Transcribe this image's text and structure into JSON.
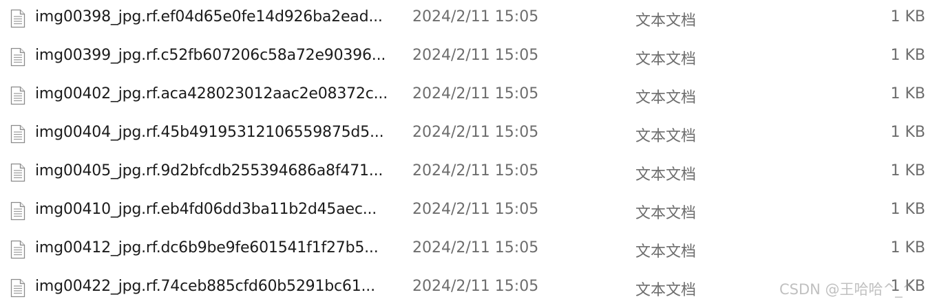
{
  "files": [
    {
      "name": "img00398_jpg.rf.ef04d65e0fe14d926ba2ead...",
      "date": "2024/2/11 15:05",
      "type": "文本文档",
      "size": "1 KB",
      "icon": "text-document-icon"
    },
    {
      "name": "img00399_jpg.rf.c52fb607206c58a72e90396...",
      "date": "2024/2/11 15:05",
      "type": "文本文档",
      "size": "1 KB",
      "icon": "text-document-icon"
    },
    {
      "name": "img00402_jpg.rf.aca428023012aac2e08372c...",
      "date": "2024/2/11 15:05",
      "type": "文本文档",
      "size": "1 KB",
      "icon": "text-document-icon"
    },
    {
      "name": "img00404_jpg.rf.45b491953121065598 75d5...",
      "date": "2024/2/11 15:05",
      "type": "文本文档",
      "size": "1 KB",
      "icon": "text-document-icon"
    },
    {
      "name": "img00405_jpg.rf.9d2bfcdb255394686a8f471...",
      "date": "2024/2/11 15:05",
      "type": "文本文档",
      "size": "1 KB",
      "icon": "text-document-icon"
    },
    {
      "name": "img00410_jpg.rf.eb4fd06dd3ba11b2d45aec...",
      "date": "2024/2/11 15:05",
      "type": "文本文档",
      "size": "1 KB",
      "icon": "text-document-icon"
    },
    {
      "name": "img00412_jpg.rf.dc6b9be9fe601541f1f27b5...",
      "date": "2024/2/11 15:05",
      "type": "文本文档",
      "size": "1 KB",
      "icon": "text-document-icon"
    },
    {
      "name": "img00422_jpg.rf.74ceb885cfd60b5291bc61...",
      "date": "2024/2/11 15:05",
      "type": "文本文档",
      "size": "1 KB",
      "icon": "text-document-icon"
    }
  ],
  "watermark": "CSDN @王哈哈^_^",
  "colors": {
    "name_text": "#1b1b1b",
    "meta_text": "#6d6d6d",
    "background": "#ffffff"
  }
}
